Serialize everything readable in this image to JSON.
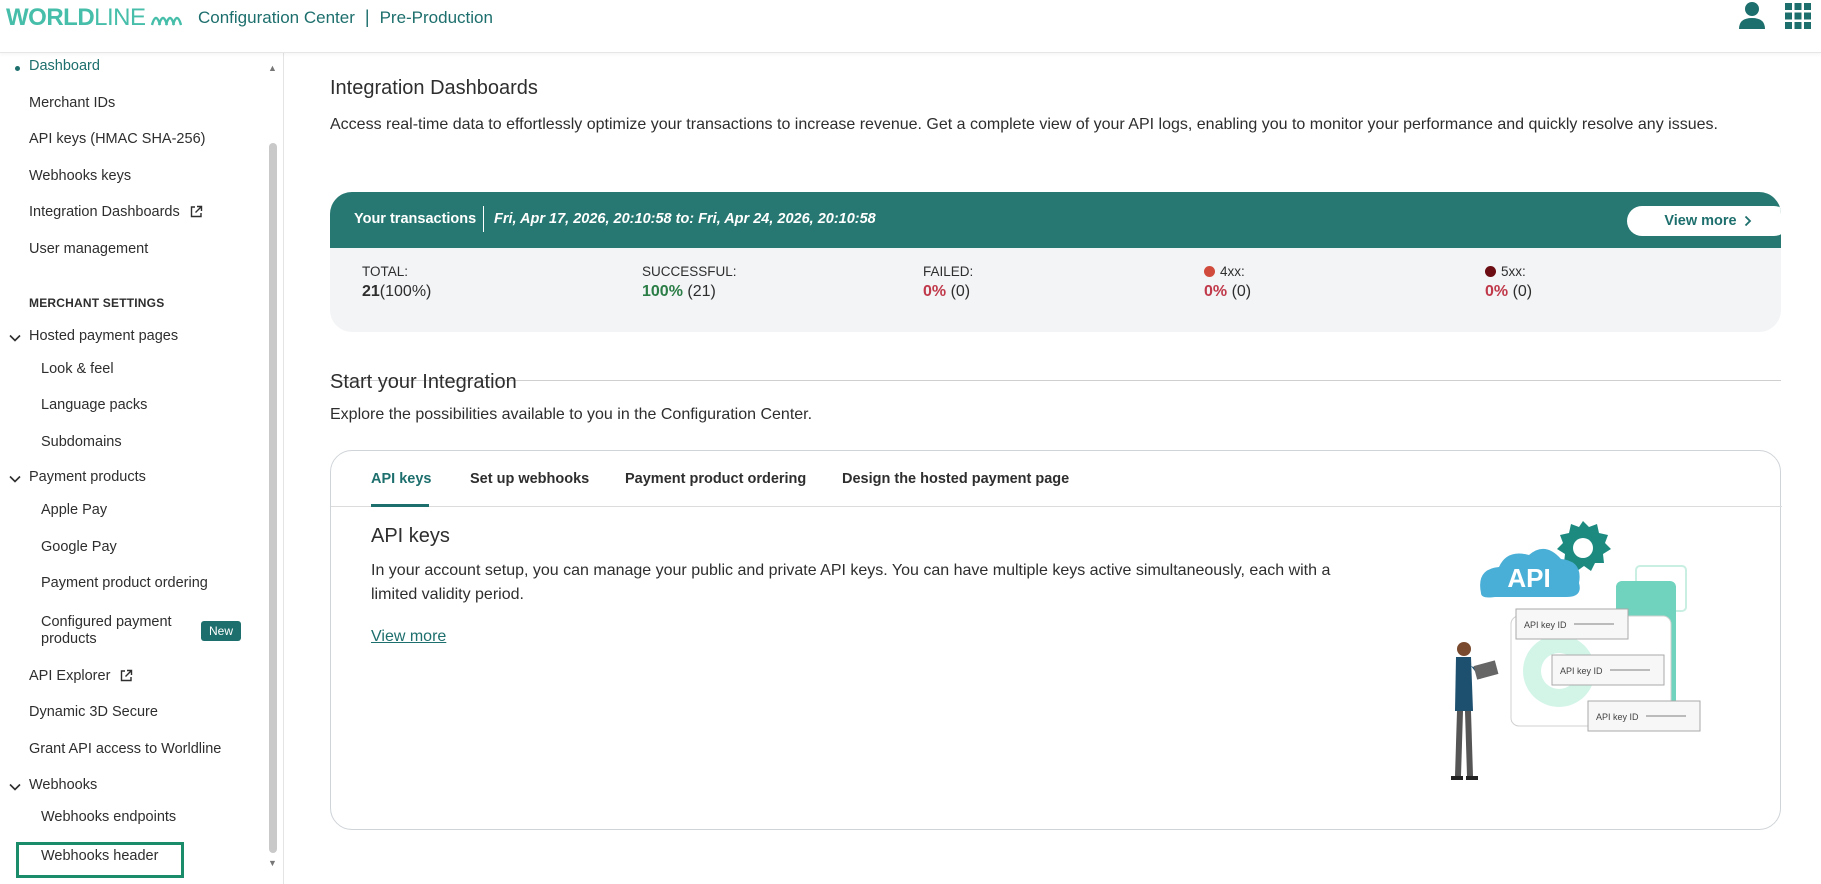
{
  "header": {
    "brand": "WORLDLINE",
    "app_name": "Configuration Center",
    "separator": "|",
    "environment": "Pre-Production",
    "icons": [
      "user-icon",
      "apps-grid-icon"
    ]
  },
  "sidebar": {
    "items": [
      {
        "label": "Dashboard",
        "active": true
      },
      {
        "label": "Merchant IDs"
      },
      {
        "label": "API keys (HMAC SHA-256)"
      },
      {
        "label": "Webhooks keys"
      },
      {
        "label": "Integration Dashboards",
        "external": true
      },
      {
        "label": "User management"
      }
    ],
    "section_label": "MERCHANT SETTINGS",
    "groups": {
      "hosted_payment_pages": "Hosted payment pages",
      "look_feel": "Look & feel",
      "language_packs": "Language packs",
      "subdomains": "Subdomains",
      "payment_products": "Payment products",
      "apple_pay": "Apple Pay",
      "google_pay": "Google Pay",
      "payment_product_ordering": "Payment product ordering",
      "configured_payment_products_1": "Configured payment",
      "configured_payment_products_2": "products",
      "new_badge": "New",
      "api_explorer": "API Explorer",
      "dynamic_3d_secure": "Dynamic 3D Secure",
      "grant_api_access": "Grant API access to Worldline",
      "webhooks": "Webhooks",
      "webhooks_endpoints": "Webhooks endpoints",
      "webhooks_header": "Webhooks header"
    }
  },
  "dashboard": {
    "title": "Integration Dashboards",
    "description": "Access real-time data to effortlessly optimize your transactions to increase revenue. Get a complete view of your API logs, enabling you to monitor your performance and quickly resolve any issues.",
    "transactions": {
      "label": "Your transactions",
      "dates": "Fri, Apr 17, 2026, 20:10:58  to: Fri, Apr 24, 2026, 20:10:58",
      "view_more": "View more",
      "stats": [
        {
          "label": "TOTAL:",
          "pct": "21",
          "count": "(100%)"
        },
        {
          "label": "SUCCESSFUL:",
          "pct": "100%",
          "count": "(21)"
        },
        {
          "label": "FAILED:",
          "pct": "0%",
          "count": "(0)"
        },
        {
          "label": "4xx:",
          "pct": "0%",
          "count": "(0)",
          "dot_color": "#d14b3c"
        },
        {
          "label": "5xx:",
          "pct": "0%",
          "count": "(0)",
          "dot_color": "#6b0d12"
        }
      ]
    }
  },
  "integration": {
    "title": "Start your Integration",
    "description": "Explore the possibilities available to you in the Configuration Center.",
    "tabs": [
      "API keys",
      "Set up webhooks",
      "Payment product ordering",
      "Design the hosted payment page"
    ],
    "active_tab": "API keys",
    "panel_title": "API keys",
    "panel_text": "In your account setup, you can manage your public and private API keys. You can have multiple keys active simultaneously, each with a limited validity period.",
    "panel_link": "View more",
    "illustration": {
      "cloud_label": "API",
      "key_label": "API key ID"
    }
  },
  "colors": {
    "brand_teal": "#1d6f6d",
    "header_teal": "#277872",
    "success": "#2a7d46",
    "error": "#c0394a"
  }
}
